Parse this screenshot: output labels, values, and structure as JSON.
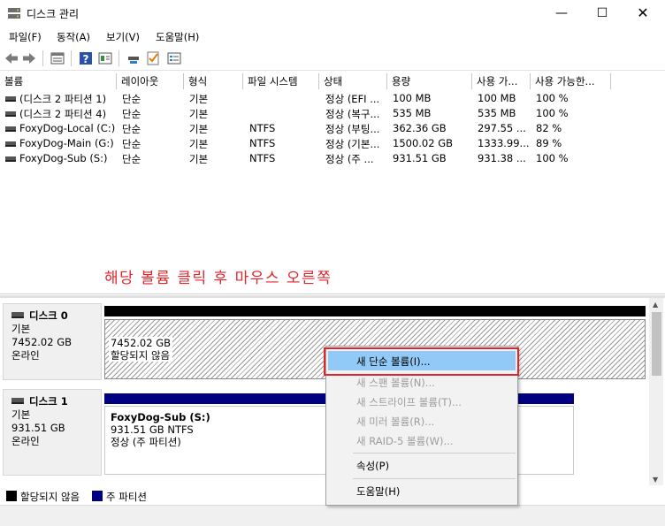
{
  "window": {
    "title": "디스크 관리",
    "controls": {
      "minimize": "—",
      "maximize": "☐",
      "close": "✕"
    }
  },
  "menu": [
    "파일(F)",
    "동작(A)",
    "보기(V)",
    "도움말(H)"
  ],
  "toolbar": {
    "icons": [
      "back-arrow-icon",
      "forward-arrow-icon",
      "list-view-icon",
      "help-icon",
      "properties-icon",
      "connect-icon",
      "check-icon",
      "detail-icon"
    ]
  },
  "columns": [
    "볼륨",
    "레이아웃",
    "형식",
    "파일 시스템",
    "상태",
    "용량",
    "사용 가...",
    "사용 가능한..."
  ],
  "volumes": [
    {
      "name": "(디스크 2 파티션 1)",
      "layout": "단순",
      "type": "기본",
      "fs": "",
      "status": "정상 (EFI ...",
      "capacity": "100 MB",
      "free": "100 MB",
      "free_pct": "100 %"
    },
    {
      "name": "(디스크 2 파티션 4)",
      "layout": "단순",
      "type": "기본",
      "fs": "",
      "status": "정상 (복구...",
      "capacity": "535 MB",
      "free": "535 MB",
      "free_pct": "100 %"
    },
    {
      "name": "FoxyDog-Local (C:)",
      "layout": "단순",
      "type": "기본",
      "fs": "NTFS",
      "status": "정상 (부팅...",
      "capacity": "362.36 GB",
      "free": "297.55 ...",
      "free_pct": "82 %"
    },
    {
      "name": "FoxyDog-Main (G:)",
      "layout": "단순",
      "type": "기본",
      "fs": "NTFS",
      "status": "정상 (기본...",
      "capacity": "1500.02 GB",
      "free": "1333.99...",
      "free_pct": "89 %"
    },
    {
      "name": "FoxyDog-Sub (S:)",
      "layout": "단순",
      "type": "기본",
      "fs": "NTFS",
      "status": "정상 (주 ...",
      "capacity": "931.51 GB",
      "free": "931.38 ...",
      "free_pct": "100 %"
    }
  ],
  "annotation": "해당 볼륨 클릭 후 마우스 오른쪽",
  "disks": [
    {
      "name": "디스크 0",
      "kind": "기본",
      "size": "7452.02 GB",
      "state": "온라인",
      "partition": {
        "size": "7452.02 GB",
        "label": "할당되지 않음"
      }
    },
    {
      "name": "디스크 1",
      "kind": "기본",
      "size": "931.51 GB",
      "state": "온라인",
      "partition": {
        "name": "FoxyDog-Sub  (S:)",
        "size": "931.51 GB NTFS",
        "status": "정상 (주 파티션)"
      }
    }
  ],
  "legend": [
    {
      "label": "할당되지 않음",
      "color": "#000000"
    },
    {
      "label": "주 파티션",
      "color": "#000080"
    }
  ],
  "context_menu": {
    "items": [
      {
        "label": "새 단순 볼륨(I)...",
        "enabled": true,
        "highlighted": true
      },
      {
        "label": "새 스팬 볼륨(N)...",
        "enabled": false
      },
      {
        "label": "새 스트라이프 볼륨(T)...",
        "enabled": false
      },
      {
        "label": "새 미러 볼륨(R)...",
        "enabled": false
      },
      {
        "label": "새 RAID-5 볼륨(W)...",
        "enabled": false
      },
      {
        "label": "속성(P)",
        "enabled": true
      },
      {
        "label": "도움말(H)",
        "enabled": true
      }
    ]
  },
  "colors": {
    "annotation": "#e0262c",
    "highlight_box": "#e0262c",
    "menu_highlight": "#91c9f7",
    "primary_partition": "#000080",
    "unallocated": "#000000"
  }
}
